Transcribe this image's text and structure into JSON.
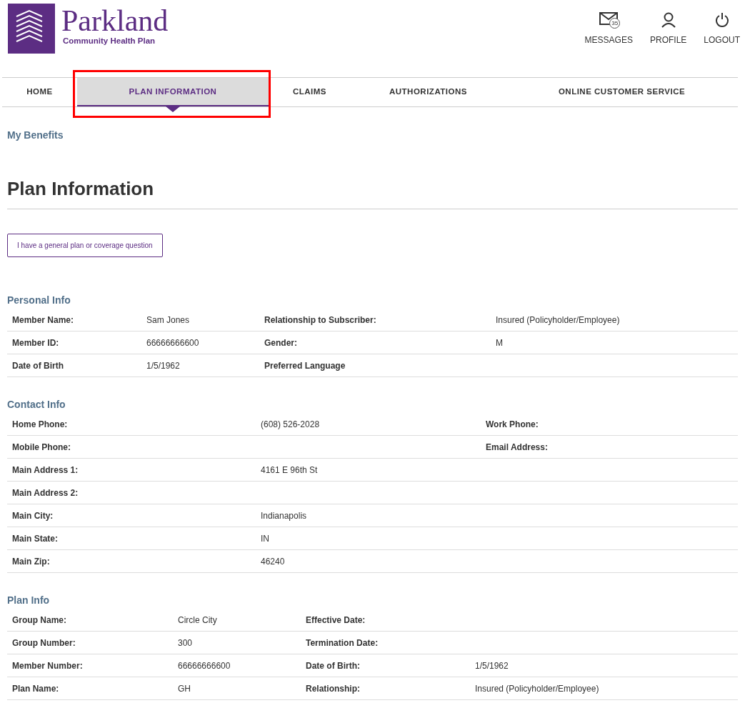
{
  "brand": {
    "name": "Parkland",
    "tagline": "Community Health Plan"
  },
  "header_actions": [
    {
      "kind": "messages",
      "label": "MESSAGES",
      "badge": "35"
    },
    {
      "kind": "profile",
      "label": "PROFILE"
    },
    {
      "kind": "logout",
      "label": "LOGOUT"
    }
  ],
  "nav": [
    {
      "label": "HOME",
      "selected": false,
      "highlighted": false
    },
    {
      "label": "PLAN INFORMATION",
      "selected": true,
      "highlighted": true
    },
    {
      "label": "CLAIMS",
      "selected": false,
      "highlighted": false
    },
    {
      "label": "AUTHORIZATIONS",
      "selected": false,
      "highlighted": false
    },
    {
      "label": "ONLINE CUSTOMER SERVICE",
      "selected": false,
      "highlighted": false
    }
  ],
  "breadcrumb": "My Benefits",
  "title": "Plan Information",
  "question_button": "I have a general plan or coverage question",
  "sections": [
    {
      "title": "Personal Info",
      "rows": [
        {
          "label": "Member Name:",
          "value": "Sam Jones",
          "label_2": "Relationship to Subscriber:",
          "value_2": "Insured (Policyholder/Employee)"
        },
        {
          "label": "Member ID:",
          "value": "66666666600",
          "label_2": "Gender:",
          "value_2": "M"
        },
        {
          "label": "Date of Birth",
          "value": "1/5/1962",
          "label_2": "Preferred Language"
        }
      ]
    },
    {
      "title": "Contact Info",
      "rows": [
        {
          "label": "Home Phone:",
          "value": "(608) 526-2028",
          "label_2": "Work Phone:"
        },
        {
          "label": "Mobile Phone:",
          "label_2": "Email Address:"
        },
        {
          "label": "Main Address 1:",
          "value": "4161 E 96th St"
        },
        {
          "label": "Main Address 2:"
        },
        {
          "label": "Main City:",
          "value": "Indianapolis"
        },
        {
          "label": "Main State:",
          "value": "IN"
        },
        {
          "label": "Main Zip:",
          "value": "46240"
        }
      ]
    },
    {
      "title": "Plan Info",
      "rows": [
        {
          "label": "Group Name:",
          "value": "Circle City",
          "label_2": "Effective Date:"
        },
        {
          "label": "Group Number:",
          "value": "300",
          "label_2": "Termination Date:"
        },
        {
          "label": "Member Number:",
          "value": "66666666600",
          "label_2": "Date of Birth:",
          "value_2": "1/5/1962"
        },
        {
          "label": "Plan Name:",
          "value": "GH",
          "label_2": "Relationship:",
          "value_2": "Insured (Policyholder/Employee)"
        }
      ]
    }
  ]
}
